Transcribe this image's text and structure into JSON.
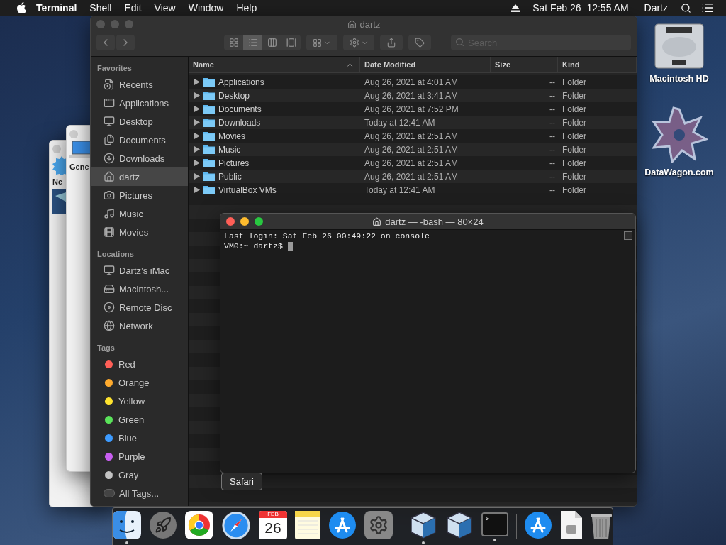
{
  "menu_bar": {
    "app": "Terminal",
    "items": [
      "Shell",
      "Edit",
      "View",
      "Window",
      "Help"
    ],
    "clock": "Sat Feb 26  12:55 AM",
    "user": "Dartz"
  },
  "background_windows": [
    {
      "label": "Ne"
    },
    {
      "label": "Gene"
    }
  ],
  "finder": {
    "title": "dartz",
    "search_placeholder": "Search",
    "view_modes": [
      {
        "kind": "icons",
        "selected": false
      },
      {
        "kind": "list",
        "selected": true
      },
      {
        "kind": "columns",
        "selected": false
      },
      {
        "kind": "gallery",
        "selected": false
      }
    ],
    "sidebar": [
      {
        "heading": "Favorites",
        "items": [
          {
            "label": "Recents",
            "selected": false
          },
          {
            "label": "Applications",
            "selected": false
          },
          {
            "label": "Desktop",
            "selected": false
          },
          {
            "label": "Documents",
            "selected": false
          },
          {
            "label": "Downloads",
            "selected": false
          },
          {
            "label": "dartz",
            "selected": true
          },
          {
            "label": "Pictures",
            "selected": false
          },
          {
            "label": "Music",
            "selected": false
          },
          {
            "label": "Movies",
            "selected": false
          }
        ]
      },
      {
        "heading": "Locations",
        "items": [
          {
            "label": "Dartz’s iMac",
            "selected": false
          },
          {
            "label": "Macintosh...",
            "selected": false
          },
          {
            "label": "Remote Disc",
            "selected": false
          },
          {
            "label": "Network",
            "selected": false
          }
        ]
      }
    ],
    "tags_heading": "Tags",
    "tags": [
      {
        "label": "Red",
        "color": "#ff5f57"
      },
      {
        "label": "Orange",
        "color": "#ffab2e"
      },
      {
        "label": "Yellow",
        "color": "#ffe32e"
      },
      {
        "label": "Green",
        "color": "#5ae35a"
      },
      {
        "label": "Blue",
        "color": "#3d9bff"
      },
      {
        "label": "Purple",
        "color": "#c85ef0"
      },
      {
        "label": "Gray",
        "color": "#c3c3c3"
      }
    ],
    "all_tags": "All Tags...",
    "columns": [
      "Name",
      "Date Modified",
      "Size",
      "Kind"
    ],
    "rows": [
      {
        "name": "Applications",
        "date": "Aug 26, 2021 at 4:01 AM",
        "size": "--",
        "kind": "Folder"
      },
      {
        "name": "Desktop",
        "date": "Aug 26, 2021 at 3:41 AM",
        "size": "--",
        "kind": "Folder"
      },
      {
        "name": "Documents",
        "date": "Aug 26, 2021 at 7:52 PM",
        "size": "--",
        "kind": "Folder"
      },
      {
        "name": "Downloads",
        "date": "Today at 12:41 AM",
        "size": "--",
        "kind": "Folder"
      },
      {
        "name": "Movies",
        "date": "Aug 26, 2021 at 2:51 AM",
        "size": "--",
        "kind": "Folder"
      },
      {
        "name": "Music",
        "date": "Aug 26, 2021 at 2:51 AM",
        "size": "--",
        "kind": "Folder"
      },
      {
        "name": "Pictures",
        "date": "Aug 26, 2021 at 2:51 AM",
        "size": "--",
        "kind": "Folder"
      },
      {
        "name": "Public",
        "date": "Aug 26, 2021 at 2:51 AM",
        "size": "--",
        "kind": "Folder"
      },
      {
        "name": "VirtualBox VMs",
        "date": "Today at 12:41 AM",
        "size": "--",
        "kind": "Folder"
      }
    ]
  },
  "terminal": {
    "title": "dartz — -bash — 80×24",
    "lines": [
      "Last login: Sat Feb 26 00:49:22 on console",
      "VM0:~ dartz$"
    ]
  },
  "desktop_icons": [
    {
      "label": "Macintosh HD",
      "kind": "disk"
    },
    {
      "label": "DataWagon.com",
      "kind": "star"
    }
  ],
  "tooltip": "Safari",
  "dock": {
    "items": [
      {
        "kind": "finder",
        "running": true
      },
      {
        "kind": "launchpad",
        "running": false
      },
      {
        "kind": "chrome",
        "running": false
      },
      {
        "kind": "safari",
        "running": false
      },
      {
        "kind": "calendar",
        "running": false,
        "month": "FEB",
        "day": "26"
      },
      {
        "kind": "notes",
        "running": false
      },
      {
        "kind": "appstore",
        "running": false
      },
      {
        "kind": "settings",
        "running": false
      },
      {
        "kind": "separator"
      },
      {
        "kind": "virtualbox",
        "running": true
      },
      {
        "kind": "virtualbox",
        "running": false
      },
      {
        "kind": "terminal",
        "running": true,
        "prompt": ">_"
      },
      {
        "kind": "separator"
      },
      {
        "kind": "appstore",
        "running": false
      },
      {
        "kind": "file",
        "running": false
      },
      {
        "kind": "trash",
        "running": false
      }
    ]
  }
}
